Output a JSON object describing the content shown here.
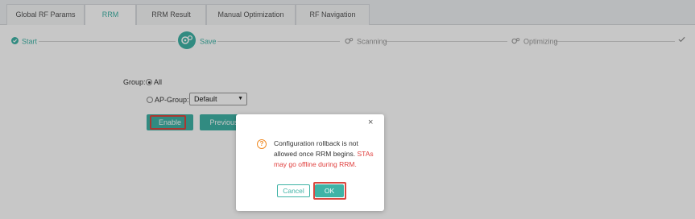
{
  "tabs": [
    {
      "label": "Global RF Params",
      "active": false
    },
    {
      "label": "RRM",
      "active": true
    },
    {
      "label": "RRM Result",
      "active": false
    },
    {
      "label": "Manual Optimization",
      "active": false
    },
    {
      "label": "RF Navigation",
      "active": false
    }
  ],
  "steps": {
    "start": "Start",
    "save": "Save",
    "scanning": "Scanning",
    "optimizing": "Optimizing"
  },
  "form": {
    "group_label": "Group:",
    "all_label": "All",
    "apgroup_label": "AP-Group:",
    "apgroup_value": "Default",
    "enable_label": "Enable",
    "previous_label": "Previous"
  },
  "dialog": {
    "close": "×",
    "warn_glyph": "?",
    "message_plain": "Configuration rollback is not allowed once RRM begins.",
    "message_red": "STAs may go offline during RRM.",
    "cancel_label": "Cancel",
    "ok_label": "OK"
  },
  "colors": {
    "accent": "#3fb3a6",
    "highlight": "#d9473f",
    "warning": "#f08a24",
    "alert_text": "#e0403f"
  }
}
